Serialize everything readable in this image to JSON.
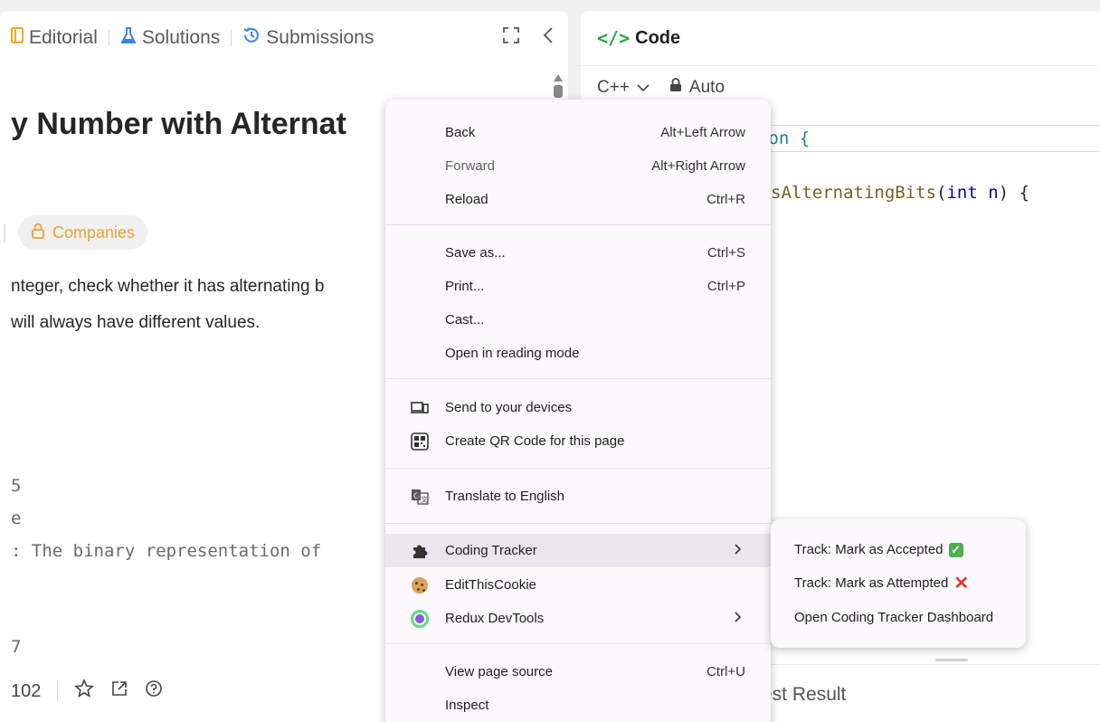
{
  "left_tabs": {
    "editorial": "Editorial",
    "solutions": "Solutions",
    "submissions": "Submissions"
  },
  "problem": {
    "title": "y Number with Alternat",
    "companies": "Companies",
    "desc_line1": "nteger, check whether it has alternating b",
    "desc_line2": "will always have different values.",
    "code_line1": "5",
    "code_line2": "e",
    "code_line3": ": The binary representation of",
    "code_line4": "7"
  },
  "bottom_bar": {
    "likes": "102"
  },
  "code_panel": {
    "title": "Code",
    "language": "C++",
    "mode": "Auto",
    "line1_tail": "ion {",
    "line2_fn": "sAlternatingBits",
    "line2_kw": "int",
    "line2_var": "n",
    "test_result": "est Result"
  },
  "context_menu": {
    "back": "Back",
    "back_shortcut": "Alt+Left Arrow",
    "forward": "Forward",
    "forward_shortcut": "Alt+Right Arrow",
    "reload": "Reload",
    "reload_shortcut": "Ctrl+R",
    "save_as": "Save as...",
    "save_as_shortcut": "Ctrl+S",
    "print": "Print...",
    "print_shortcut": "Ctrl+P",
    "cast": "Cast...",
    "reading_mode": "Open in reading mode",
    "send_devices": "Send to your devices",
    "qr_code": "Create QR Code for this page",
    "translate": "Translate to English",
    "coding_tracker": "Coding Tracker",
    "edit_this_cookie": "EditThisCookie",
    "redux_devtools": "Redux DevTools",
    "view_source": "View page source",
    "view_source_shortcut": "Ctrl+U",
    "inspect": "Inspect"
  },
  "sub_menu": {
    "mark_accepted": "Track: Mark as Accepted",
    "mark_attempted": "Track: Mark as Attempted",
    "open_dashboard": "Open Coding Tracker Dashboard"
  },
  "colors": {
    "accent_green": "#22a84a",
    "companies_orange": "#e6a23c",
    "menu_bg": "#fcf8fd"
  }
}
